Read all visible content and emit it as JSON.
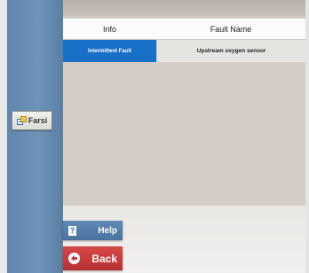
{
  "sidebar": {
    "language_button": {
      "label": "Farsi",
      "icon": "language-switch-icon"
    }
  },
  "fault_table": {
    "headers": {
      "info": "Info",
      "fault_name": "Fault Name"
    },
    "rows": [
      {
        "info": "Intermittent Fault",
        "fault_name": "Upstream oxygen sensor"
      }
    ]
  },
  "actions": {
    "help": {
      "label": "Help",
      "icon": "question-mark-icon"
    },
    "back": {
      "label": "Back",
      "icon": "back-arrow-icon"
    }
  },
  "colors": {
    "sidebar": "#6a8fb5",
    "selected_cell": "#1870c9",
    "help_button": "#5279a6",
    "back_button": "#c83a3a"
  }
}
